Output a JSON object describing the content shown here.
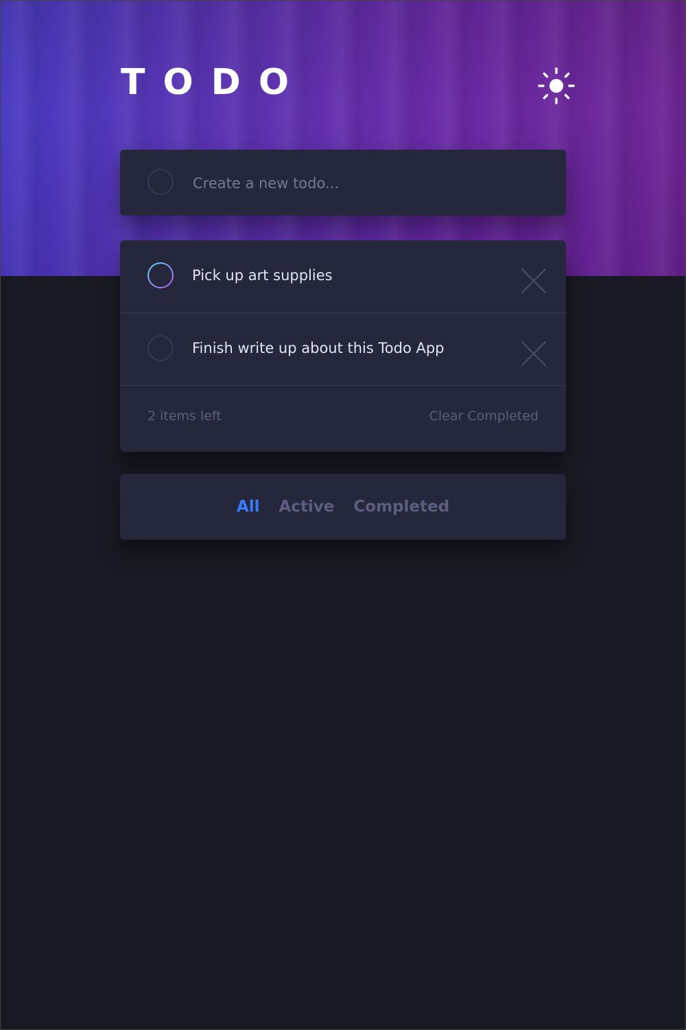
{
  "header": {
    "title": "TODO",
    "theme_toggle_icon": "sun-icon"
  },
  "new_todo": {
    "placeholder": "Create a new todo...",
    "value": ""
  },
  "todos": [
    {
      "text": "Pick up art supplies",
      "completed": false
    },
    {
      "text": "Finish write up about this Todo App",
      "completed": false
    }
  ],
  "footer": {
    "items_left": "2 items left",
    "clear_label": "Clear Completed"
  },
  "filters": {
    "all": "All",
    "active": "Active",
    "completed": "Completed",
    "selected": "All"
  },
  "colors": {
    "accent": "#3a7bfd",
    "card_bg": "#25273c",
    "page_bg": "#181922",
    "check_gradient_start": "#55ddff",
    "check_gradient_end": "#c058f3"
  }
}
